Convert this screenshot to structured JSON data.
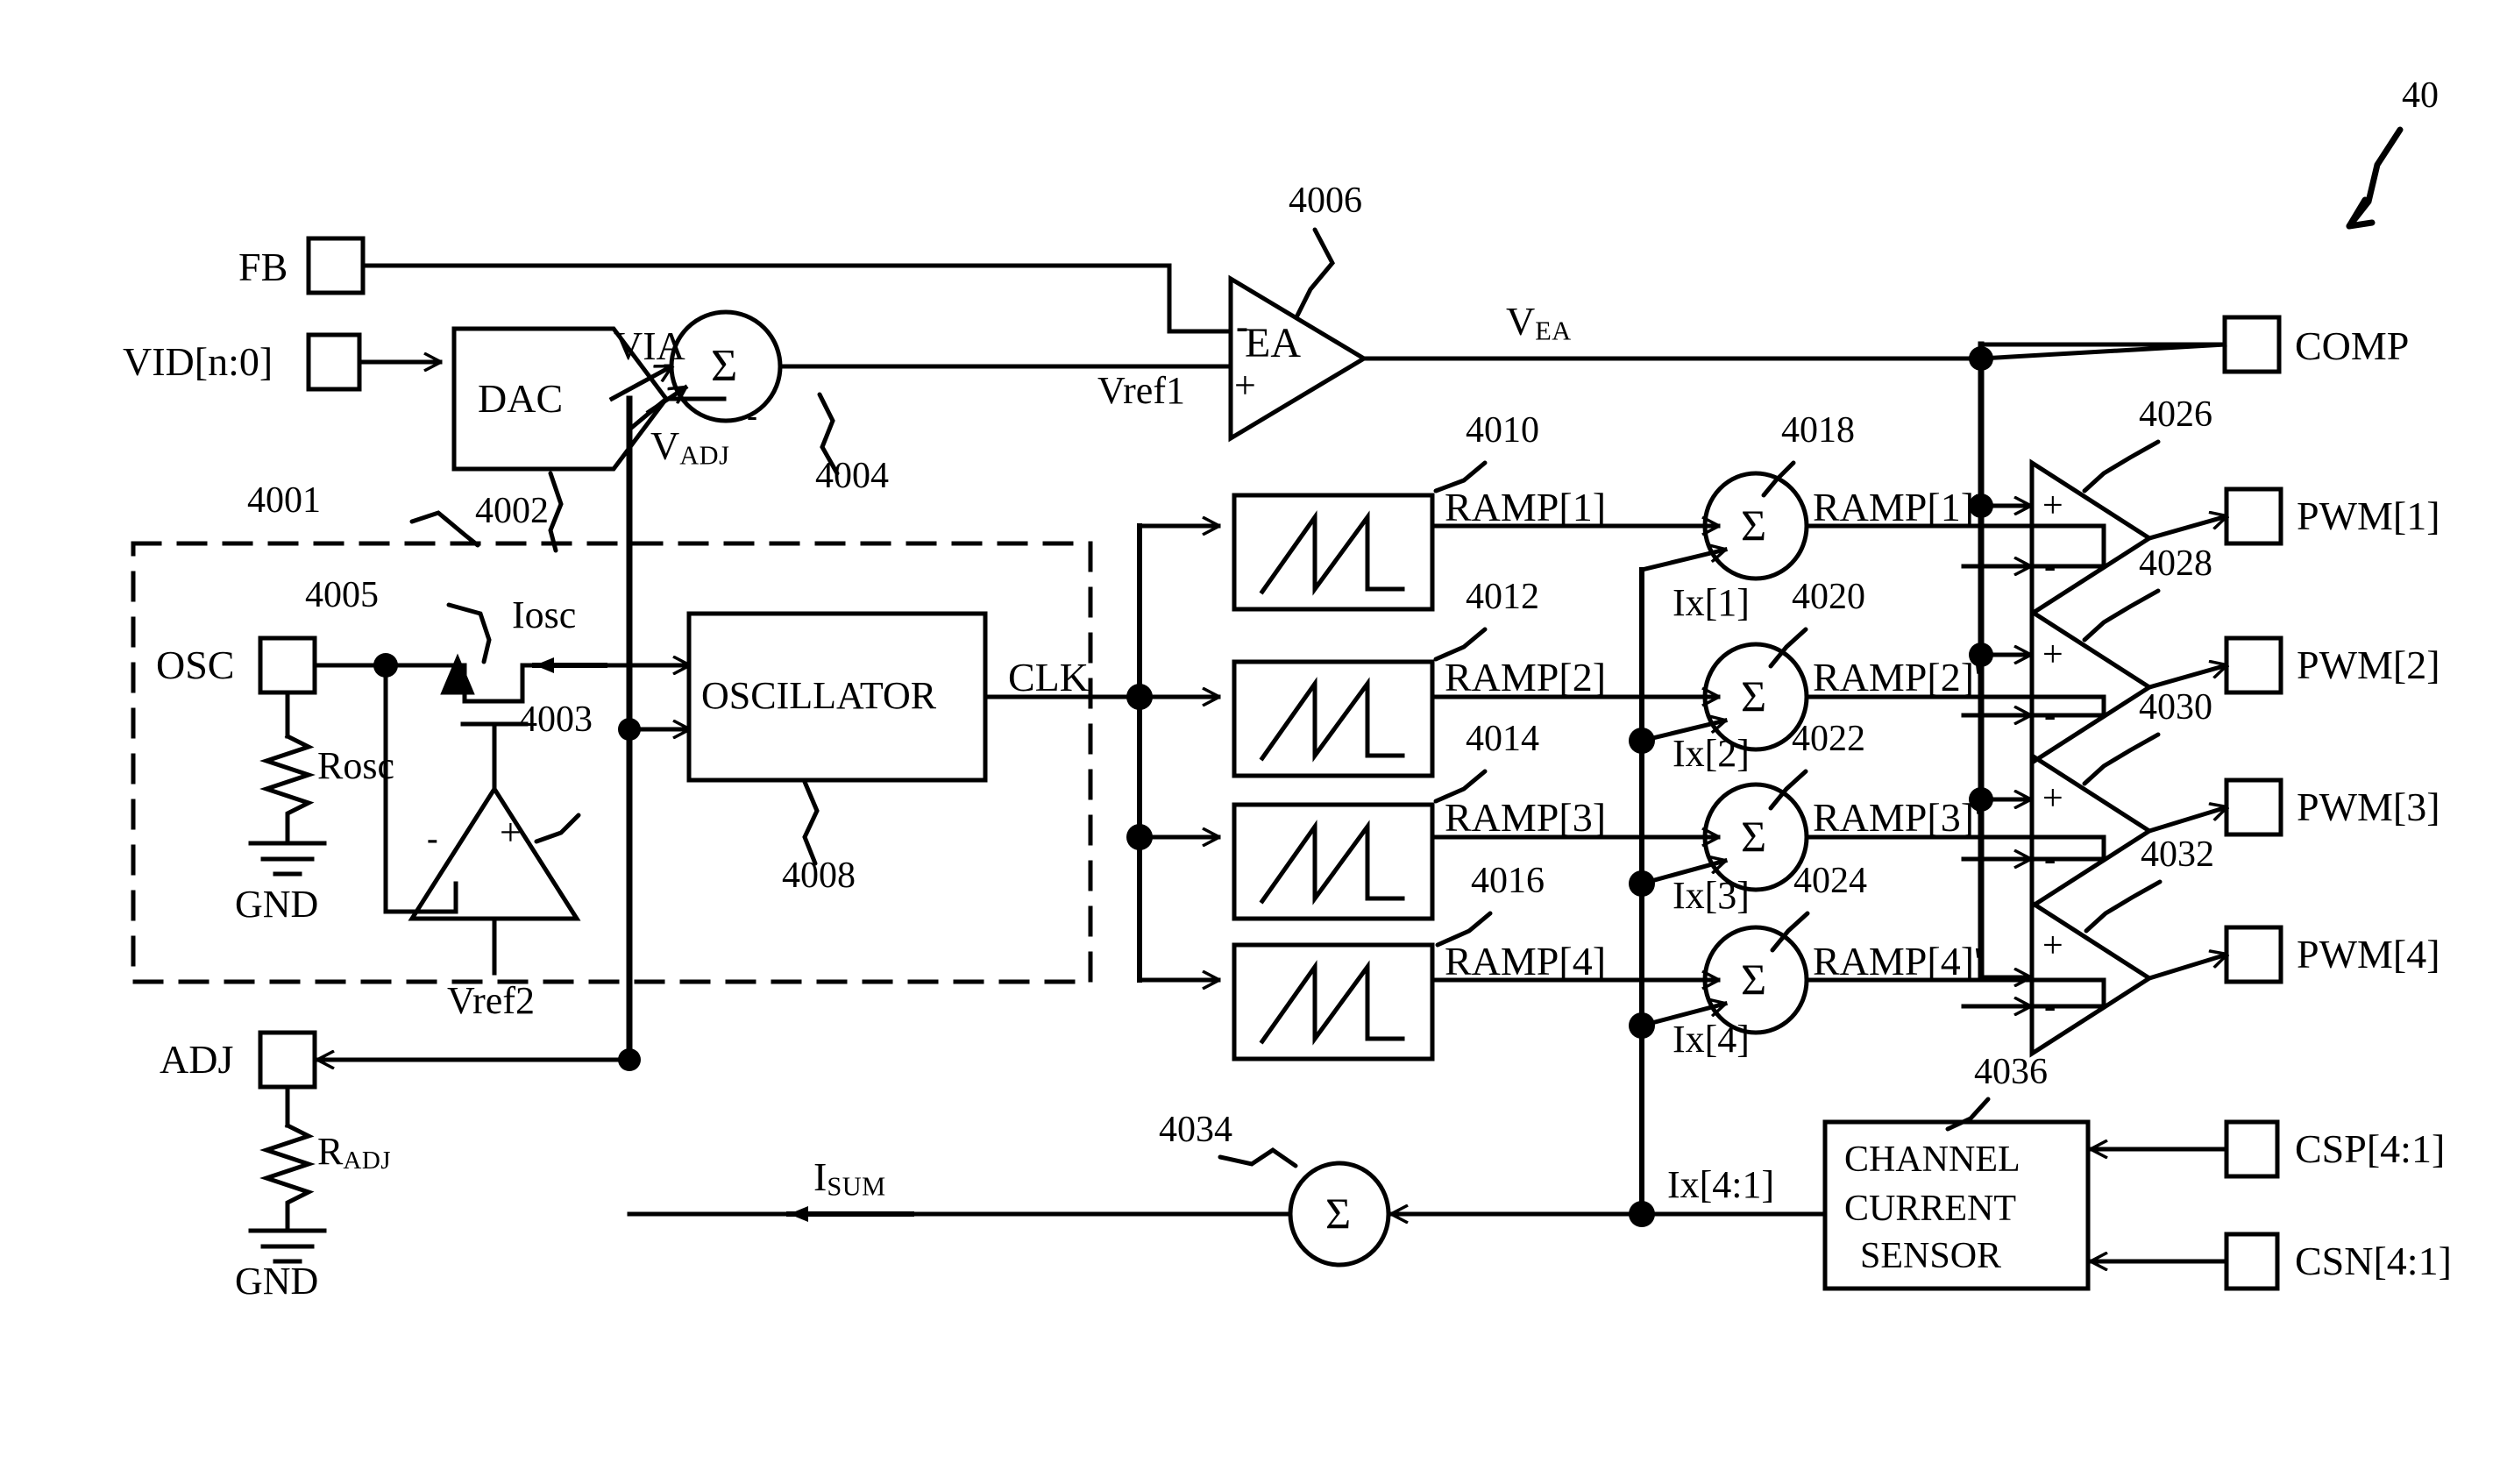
{
  "figure": {
    "number": "40",
    "title_ref": "40"
  },
  "pads": {
    "fb": "FB",
    "vid": "VID[n:0]",
    "comp": "COMP",
    "osc": "OSC",
    "adj": "ADJ",
    "pwm1": "PWM[1]",
    "pwm2": "PWM[2]",
    "pwm3": "PWM[3]",
    "pwm4": "PWM[4]",
    "csp": "CSP[4:1]",
    "csn": "CSN[4:1]"
  },
  "blocks": {
    "dac": "DAC",
    "oscillator": "OSCILLATOR",
    "channel_current_sensor_l1": "CHANNEL",
    "channel_current_sensor_l2": "CURRENT",
    "channel_current_sensor_l3": "SENSOR",
    "ea": "EA",
    "sigma": "Σ"
  },
  "signals": {
    "via": "VIA",
    "vadj_main": "V",
    "vadj_sub": "ADJ",
    "vref1": "Vref1",
    "vref2": "Vref2",
    "vea_main": "V",
    "vea_sub": "EA",
    "iosc": "Iosc",
    "clk": "CLK",
    "isum_main": "I",
    "isum_sub": "SUM",
    "rosc": "Rosc",
    "radj_main": "R",
    "radj_sub": "ADJ",
    "gnd1": "GND",
    "gnd2": "GND",
    "ramp1": "RAMP[1]",
    "ramp2": "RAMP[2]",
    "ramp3": "RAMP[3]",
    "ramp4": "RAMP[4]",
    "ramp1p": "RAMP[1]'",
    "ramp2p": "RAMP[2]'",
    "ramp3p": "RAMP[3]'",
    "ramp4p": "RAMP[4]'",
    "ix1": "Ix[1]",
    "ix2": "Ix[2]",
    "ix3": "Ix[3]",
    "ix4": "Ix[4]",
    "ixbus": "Ix[4:1]",
    "ixbus2": "Ix[4:1]",
    "plus": "+",
    "minus": "-"
  },
  "refs": {
    "r4001": "4001",
    "r4002": "4002",
    "r4003": "4003",
    "r4004": "4004",
    "r4005": "4005",
    "r4006": "4006",
    "r4008": "4008",
    "r4010": "4010",
    "r4012": "4012",
    "r4014": "4014",
    "r4016": "4016",
    "r4018": "4018",
    "r4020": "4020",
    "r4022": "4022",
    "r4024": "4024",
    "r4026": "4026",
    "r4028": "4028",
    "r4030": "4030",
    "r4032": "4032",
    "r4034": "4034",
    "r4036": "4036"
  }
}
